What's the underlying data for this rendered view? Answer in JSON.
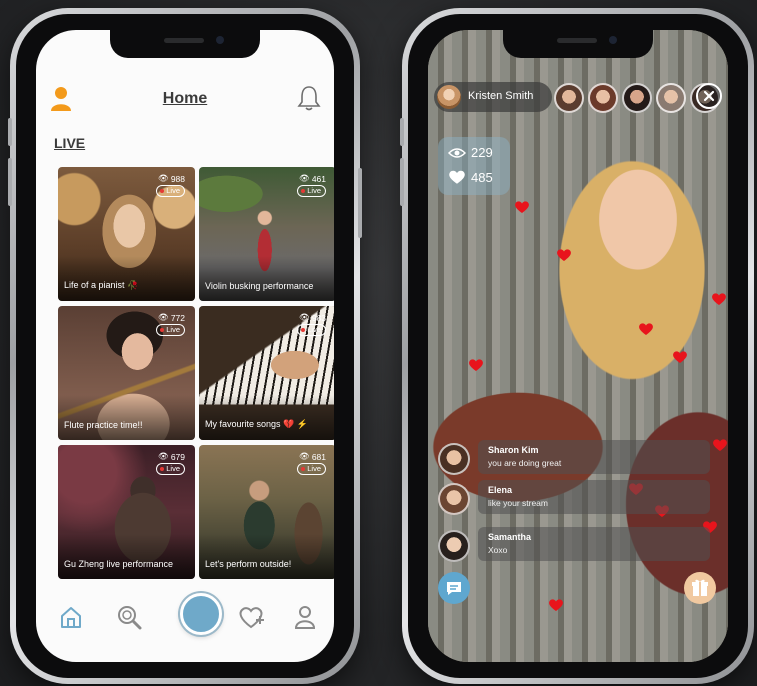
{
  "left_phone": {
    "header": {
      "title": "Home",
      "profile_icon": "user-icon",
      "notification_icon": "bell-icon"
    },
    "section_label": "LIVE",
    "cards": [
      {
        "title": "Life of a pianist 🥀",
        "views": "988",
        "badge": "Live"
      },
      {
        "title": "Violin busking performance",
        "views": "461",
        "badge": "Live"
      },
      {
        "title": "Flute practice time!!",
        "views": "772",
        "badge": "Live"
      },
      {
        "title": "My favourite songs 💔 ⚡",
        "views": "983",
        "badge": "Live"
      },
      {
        "title": "Gu Zheng live performance",
        "views": "679",
        "badge": "Live"
      },
      {
        "title": "Let's perform outside!",
        "views": "681",
        "badge": "Live"
      }
    ],
    "tabbar": {
      "items": [
        "home-icon",
        "search-icon",
        "record-icon",
        "heart-plus-icon",
        "profile-icon"
      ],
      "accent": "#6fa9c9"
    }
  },
  "right_phone": {
    "host": {
      "name": "Kristen Smith"
    },
    "stats": {
      "viewers": "229",
      "likes": "485"
    },
    "comments": [
      {
        "name": "Sharon Kim",
        "text": "you are doing great"
      },
      {
        "name": "Elena",
        "text": "like your stream"
      },
      {
        "name": "Samantha",
        "text": "Xoxo"
      }
    ],
    "heart_color": "#e8141c",
    "chat_button_color": "#5fa7cf",
    "gift_button_color": "#f1c9a0"
  }
}
